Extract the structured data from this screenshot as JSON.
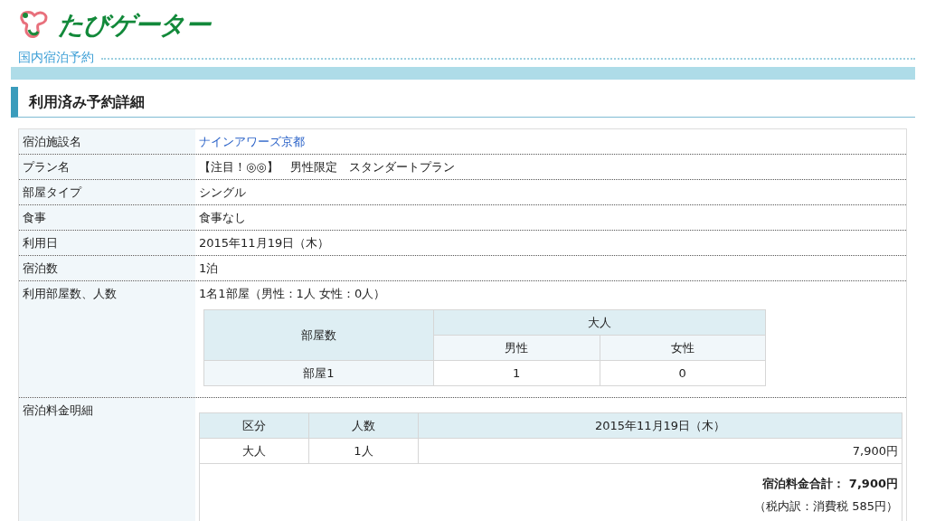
{
  "logo": {
    "text": "たびゲーター"
  },
  "section": "国内宿泊予約",
  "heading": "利用済み予約詳細",
  "details": [
    {
      "label": "宿泊施設名",
      "value": "ナインアワーズ京都",
      "kind": "link"
    },
    {
      "label": "プラン名",
      "value": "【注目！◎◎】　男性限定　スタンダートプラン",
      "kind": "text"
    },
    {
      "label": "部屋タイプ",
      "value": "シングル",
      "kind": "text"
    },
    {
      "label": "食事",
      "value": "食事なし",
      "kind": "text"
    },
    {
      "label": "利用日",
      "value": "2015年11月19日（木）",
      "kind": "text"
    },
    {
      "label": "宿泊数",
      "value": "1泊",
      "kind": "text"
    }
  ],
  "rooms": {
    "label": "利用部屋数、人数",
    "summary": "1名1部屋（男性：1人 女性：0人）",
    "rooms_header": "部屋数",
    "adult_header": "大人",
    "male_header": "男性",
    "female_header": "女性",
    "rows": [
      {
        "room": "部屋1",
        "male": "1",
        "female": "0"
      }
    ]
  },
  "fees": {
    "label": "宿泊料金明細",
    "columns": [
      "区分",
      "人数",
      "2015年11月19日（木）"
    ],
    "rows": [
      [
        "大人",
        "1人",
        "7,900円"
      ]
    ],
    "total": "宿泊料金合計： 7,900円",
    "tax_note": "（税内訳：消費税 585円）"
  }
}
